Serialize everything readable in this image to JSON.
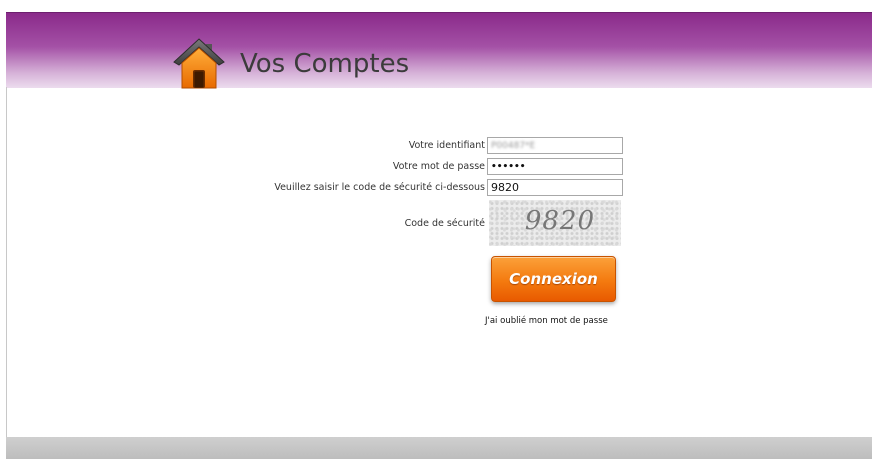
{
  "header": {
    "title": "Vos Comptes",
    "logo_icon": "house-icon",
    "colors": {
      "header_top": "#8a2a8a",
      "header_bottom": "#ecdcee"
    }
  },
  "form": {
    "identifiant_label": "Votre identifiant",
    "identifiant_value": "P00487*E",
    "password_label": "Votre mot de passe",
    "password_value": "••••••",
    "security_input_label": "Veuillez saisir le code de sécurité ci-dessous",
    "security_input_value": "9820",
    "captcha_label": "Code de sécurité",
    "captcha_code": "9820",
    "submit_label": "Connexion",
    "forgot_link": "J'ai oublié mon mot de passe"
  },
  "colors": {
    "button": "#f47a0f",
    "footer": "#c4c4c4"
  }
}
